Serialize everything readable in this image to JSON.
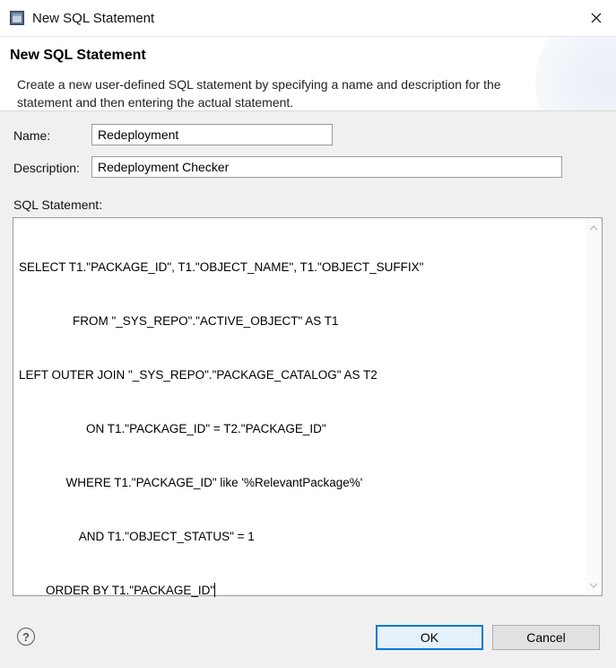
{
  "window": {
    "title": "New SQL Statement",
    "close_icon": "close-icon"
  },
  "banner": {
    "title": "New SQL Statement",
    "description": "Create a new user-defined SQL statement by specifying a name and description for the statement and then entering the actual statement."
  },
  "form": {
    "name_label": "Name:",
    "name_value": "Redeployment",
    "description_label": "Description:",
    "description_value": "Redeployment Checker",
    "sql_label": "SQL Statement:",
    "sql_lines": [
      "SELECT T1.\"PACKAGE_ID\", T1.\"OBJECT_NAME\", T1.\"OBJECT_SUFFIX\"",
      "                FROM \"_SYS_REPO\".\"ACTIVE_OBJECT\" AS T1",
      "LEFT OUTER JOIN \"_SYS_REPO\".\"PACKAGE_CATALOG\" AS T2",
      "                    ON T1.\"PACKAGE_ID\" = T2.\"PACKAGE_ID\"",
      "              WHERE T1.\"PACKAGE_ID\" like '%RelevantPackage%'",
      "                  AND T1.\"OBJECT_STATUS\" = 1",
      "        ORDER BY T1.\"PACKAGE_ID\""
    ]
  },
  "footer": {
    "help_symbol": "?",
    "ok_label": "OK",
    "cancel_label": "Cancel"
  },
  "colors": {
    "accent": "#0078d7",
    "dialog_bg": "#f0f0f0"
  }
}
